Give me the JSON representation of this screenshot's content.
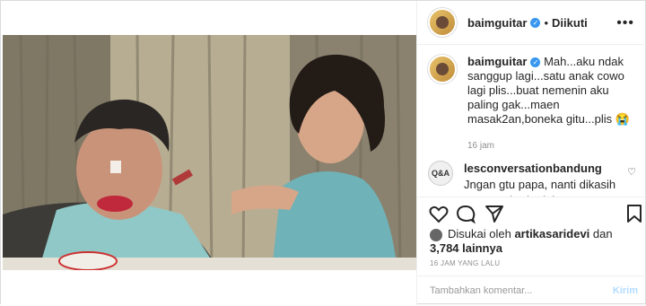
{
  "header": {
    "username": "baimguitar",
    "separator": "•",
    "follow_status": "Diikuti",
    "more_label": "•••"
  },
  "caption": {
    "username": "baimguitar",
    "text": "Mah...aku ndak sanggup lagi...satu anak cowo lagi plis...buat nemenin aku paling gak...maen masak2an,boneka gitu...plis 😭",
    "time": "16 jam"
  },
  "comment": {
    "avatar_text": "Q&A",
    "username": "lesconversationbandung",
    "text": "Jngan gtu papa, nanti dikasih cowo yg beda deh, cowo yg nemenin aku"
  },
  "likes": {
    "prefix": "Disukai oleh",
    "user": "artikasaridevi",
    "and": "dan",
    "count": "3,784 lainnya"
  },
  "timestamp": "16 JAM YANG LALU",
  "add_comment": {
    "placeholder": "Tambahkan komentar...",
    "post_label": "Kirim"
  },
  "icons": [
    "heart-icon",
    "comment-icon",
    "share-icon",
    "bookmark-icon",
    "small-heart-icon",
    "verified-icon"
  ]
}
